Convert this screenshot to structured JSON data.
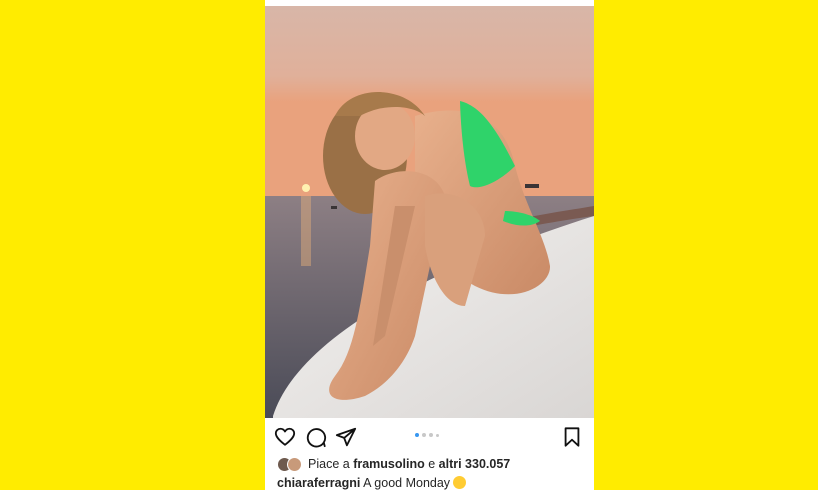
{
  "post": {
    "likes": {
      "prefix": "Piace a",
      "user": "framusolino",
      "connector": "e",
      "others": "altri 330.057"
    },
    "caption": {
      "username": "chiaraferragni",
      "text": "A good Monday",
      "emoji": "smiling-face-with-tear"
    },
    "carousel": {
      "count": 4,
      "active": 0
    },
    "icons": [
      "heart-icon",
      "comment-icon",
      "share-icon",
      "bookmark-icon"
    ]
  },
  "colors": {
    "background": "#ffec00",
    "active_dot": "#3897f0",
    "bikini": "#2fd36a"
  }
}
